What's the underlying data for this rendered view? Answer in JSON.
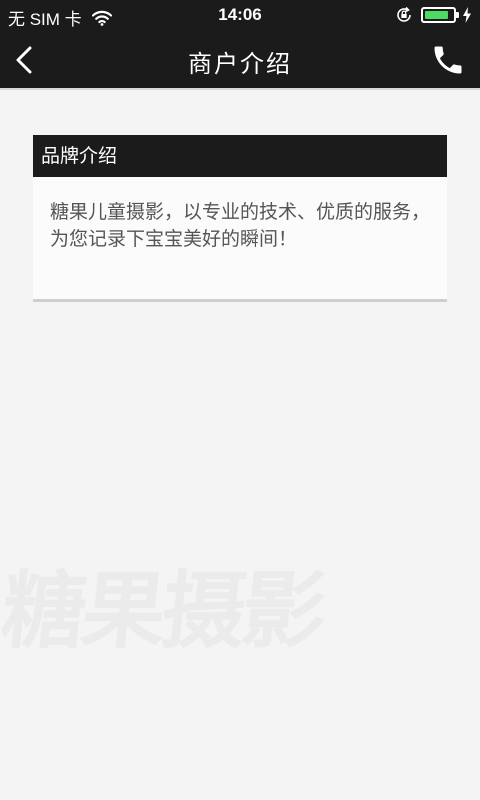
{
  "status_bar": {
    "carrier": "无 SIM 卡",
    "time": "14:06",
    "battery_level": 0.85,
    "battery_color": "#4cd964",
    "icons": [
      "wifi-icon",
      "rotation-lock-icon",
      "battery-icon",
      "charging-icon"
    ]
  },
  "nav": {
    "title": "商户介绍",
    "back_icon": "chevron-left-icon",
    "call_icon": "phone-icon"
  },
  "brand": {
    "header": "品牌介绍",
    "description": "糖果儿童摄影，以专业的技术、优质的服务，为您记录下宝宝美好的瞬间！"
  },
  "watermark": {
    "text": "糖果摄影"
  },
  "colors": {
    "bar_background": "#1b1b1b",
    "page_background": "#f4f4f4",
    "card_background": "#fbfbfb",
    "body_text": "#555555"
  }
}
